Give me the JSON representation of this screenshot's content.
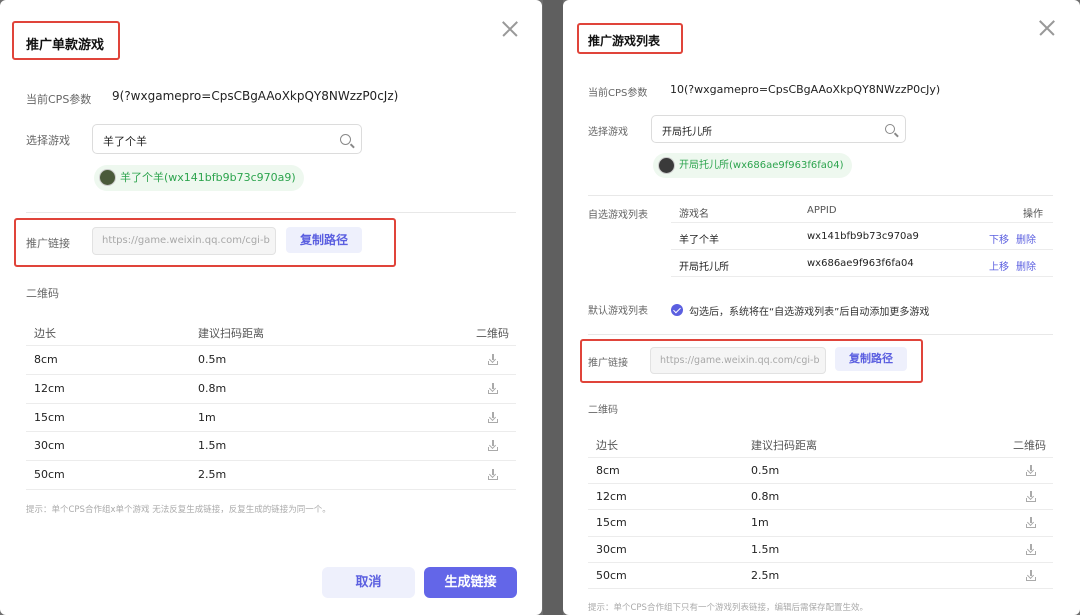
{
  "left": {
    "title": "推广单款游戏",
    "cps_label": "当前CPS参数",
    "cps_value": "9(?wxgamepro=CpsCBgAAoXkpQY8NWzzP0cJz)",
    "select_label": "选择游戏",
    "search_value": "羊了个羊",
    "chip": "羊了个羊(wx141bfb9b73c970a9)",
    "link_label": "推广链接",
    "link_value": "https://game.weixin.qq.com/cgi-b",
    "copy_label": "复制路径",
    "qr_label": "二维码",
    "headers": [
      "边长",
      "建议扫码距离",
      "二维码"
    ],
    "rows": [
      {
        "size": "8cm",
        "dist": "0.5m"
      },
      {
        "size": "12cm",
        "dist": "0.8m"
      },
      {
        "size": "15cm",
        "dist": "1m"
      },
      {
        "size": "30cm",
        "dist": "1.5m"
      },
      {
        "size": "50cm",
        "dist": "2.5m"
      }
    ],
    "hint": "提示：单个CPS合作组x单个游戏 无法反复生成链接，反复生成的链接为同一个。",
    "cancel": "取消",
    "generate": "生成链接"
  },
  "right": {
    "title": "推广游戏列表",
    "cps_label": "当前CPS参数",
    "cps_value": "10(?wxgamepro=CpsCBgAAoXkpQY8NWzzP0cJy)",
    "select_label": "选择游戏",
    "search_value": "开局托儿所",
    "chip": "开局托儿所(wx686ae9f963f6fa04)",
    "custom_label": "自选游戏列表",
    "list_headers": [
      "游戏名",
      "APPID",
      "操作"
    ],
    "list_rows": [
      {
        "name": "羊了个羊",
        "appid": "wx141bfb9b73c970a9",
        "move": "下移",
        "del": "删除"
      },
      {
        "name": "开局托儿所",
        "appid": "wx686ae9f963f6fa04",
        "move": "上移",
        "del": "删除"
      }
    ],
    "default_label": "默认游戏列表",
    "default_text": "勾选后，系统将在“自选游戏列表”后自动添加更多游戏",
    "link_label": "推广链接",
    "link_value": "https://game.weixin.qq.com/cgi-b",
    "copy_label": "复制路径",
    "qr_label": "二维码",
    "headers": [
      "边长",
      "建议扫码距离",
      "二维码"
    ],
    "rows": [
      {
        "size": "8cm",
        "dist": "0.5m"
      },
      {
        "size": "12cm",
        "dist": "0.8m"
      },
      {
        "size": "15cm",
        "dist": "1m"
      },
      {
        "size": "30cm",
        "dist": "1.5m"
      },
      {
        "size": "50cm",
        "dist": "2.5m"
      }
    ],
    "hint": "提示：单个CPS合作组下只有一个游戏列表链接，编辑后需保存配置生效。"
  },
  "colors": {
    "accent": "#5b5fe0",
    "primary_button": "#6366e8",
    "chip_text": "#2da44e",
    "highlight_box": "#e0443a"
  }
}
